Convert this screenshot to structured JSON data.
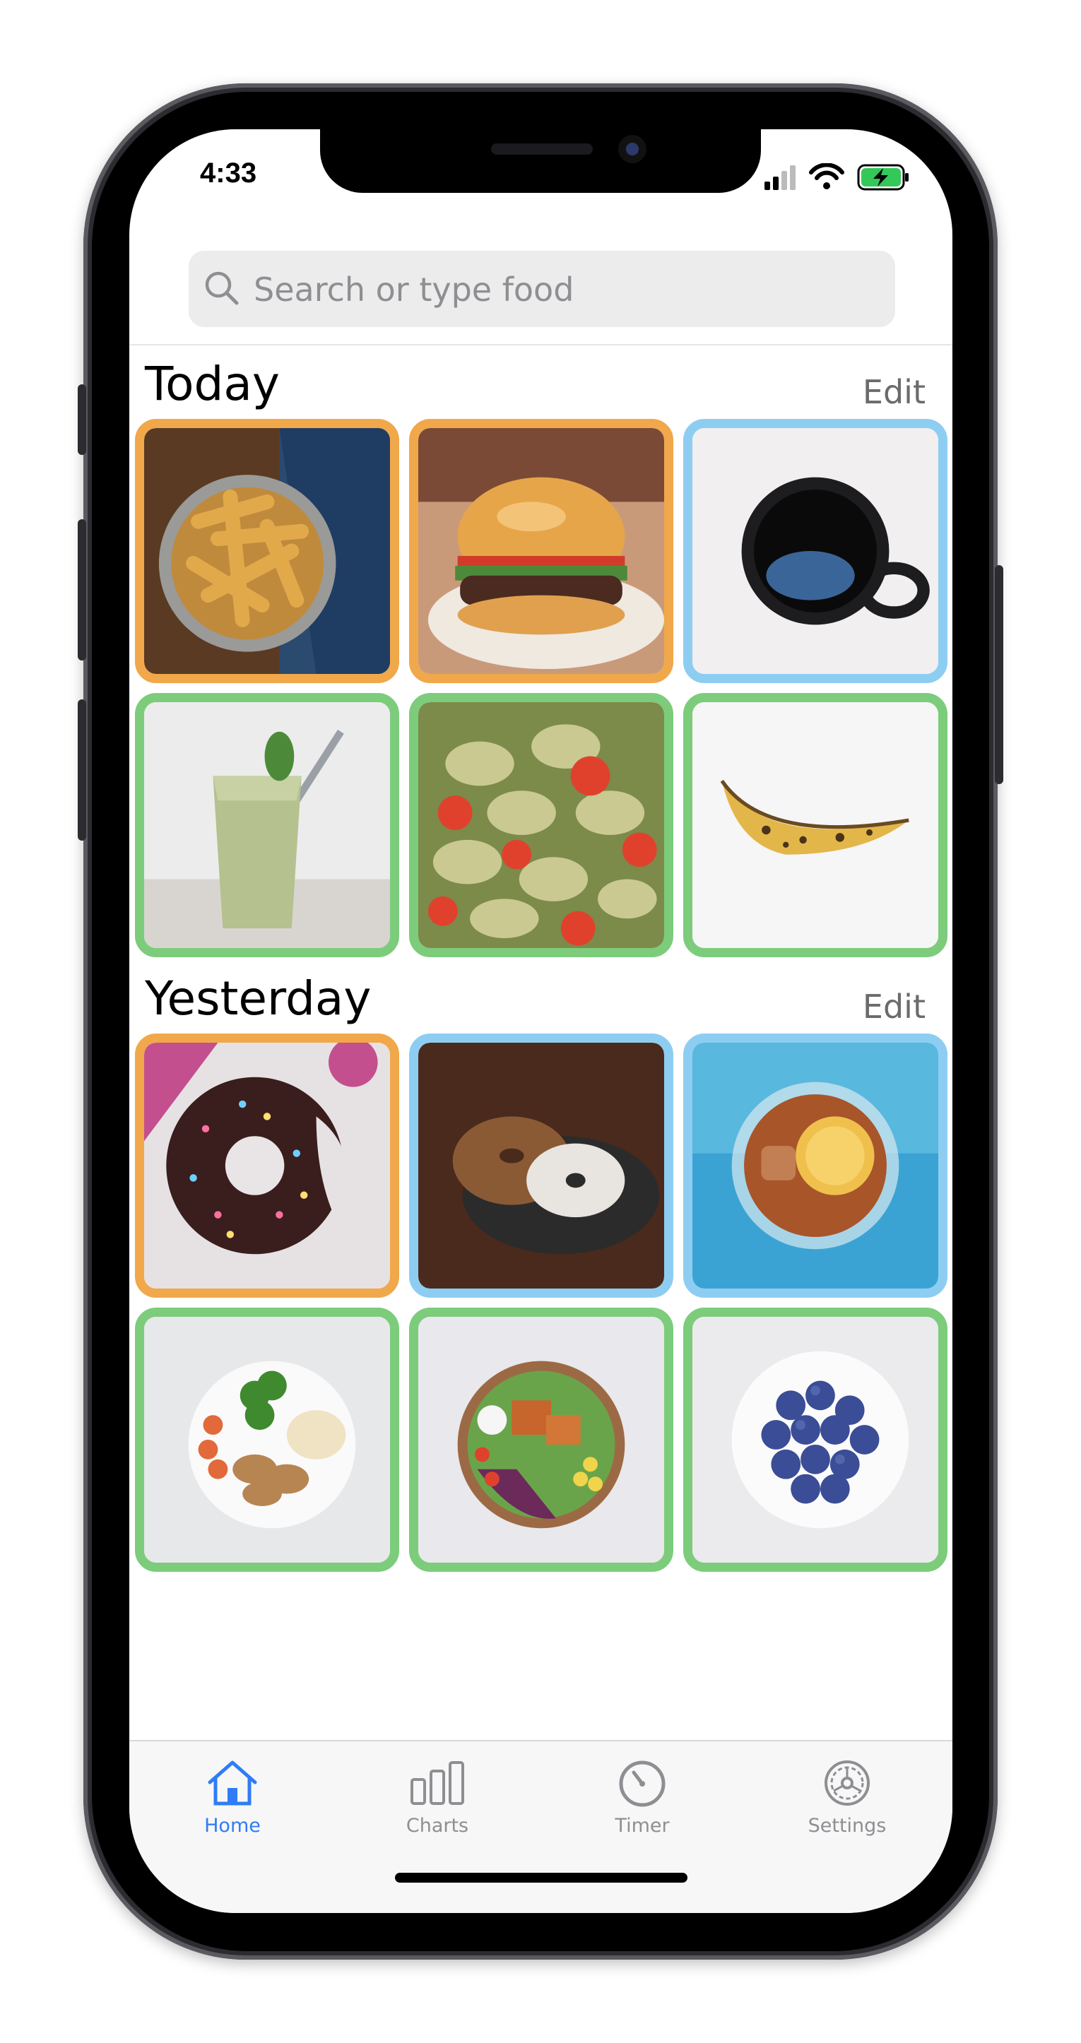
{
  "status_bar": {
    "time": "4:33"
  },
  "search": {
    "placeholder": "Search or type food"
  },
  "sections": [
    {
      "title": "Today",
      "edit_label": "Edit",
      "items": [
        {
          "food": "fries",
          "rating": "orange"
        },
        {
          "food": "burger",
          "rating": "orange"
        },
        {
          "food": "black coffee",
          "rating": "blue"
        },
        {
          "food": "green smoothie",
          "rating": "green"
        },
        {
          "food": "pesto pasta",
          "rating": "green"
        },
        {
          "food": "banana",
          "rating": "green"
        }
      ]
    },
    {
      "title": "Yesterday",
      "edit_label": "Edit",
      "items": [
        {
          "food": "chocolate donut",
          "rating": "orange"
        },
        {
          "food": "bagel",
          "rating": "blue"
        },
        {
          "food": "iced tea with lemon",
          "rating": "blue"
        },
        {
          "food": "chicken with broccoli",
          "rating": "green"
        },
        {
          "food": "salad bowl",
          "rating": "green"
        },
        {
          "food": "blueberries",
          "rating": "green"
        }
      ]
    }
  ],
  "rating_colors": {
    "orange": "#f0a84a",
    "blue": "#8ecdf2",
    "green": "#7ccc7c"
  },
  "tabs": [
    {
      "label": "Home",
      "icon": "home-icon",
      "active": true
    },
    {
      "label": "Charts",
      "icon": "charts-icon",
      "active": false
    },
    {
      "label": "Timer",
      "icon": "timer-icon",
      "active": false
    },
    {
      "label": "Settings",
      "icon": "settings-icon",
      "active": false
    }
  ],
  "colors": {
    "accent": "#2f7cf6",
    "inactive": "#8e8e93"
  }
}
